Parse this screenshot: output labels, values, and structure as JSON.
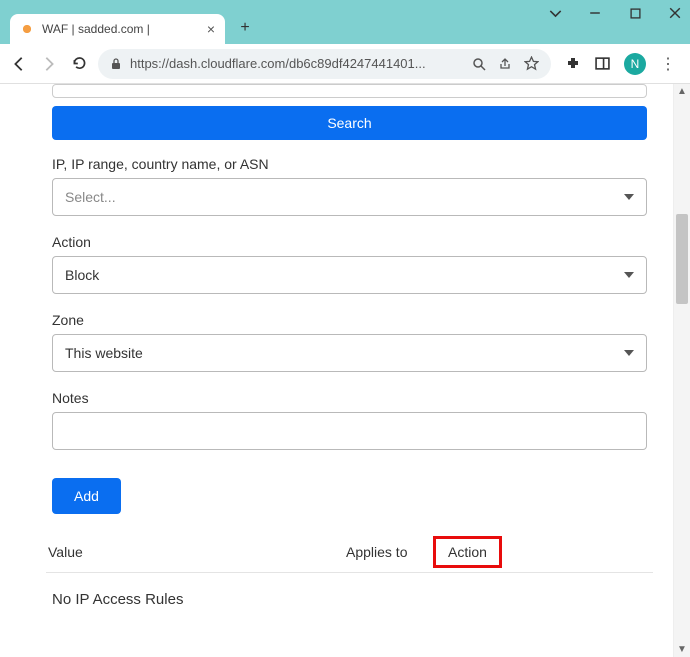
{
  "browser": {
    "tab_title": "WAF | sadded.com |",
    "url_display": "https://dash.cloudflare.com/db6c89df4247441401...",
    "avatar_letter": "N"
  },
  "page": {
    "search_button": "Search",
    "ip_label": "IP, IP range, country name, or ASN",
    "ip_placeholder": "Select...",
    "action_label": "Action",
    "action_value": "Block",
    "zone_label": "Zone",
    "zone_value": "This website",
    "notes_label": "Notes",
    "add_button": "Add",
    "table": {
      "col_value": "Value",
      "col_applies": "Applies to",
      "col_action": "Action",
      "empty_message": "No IP Access Rules"
    }
  }
}
